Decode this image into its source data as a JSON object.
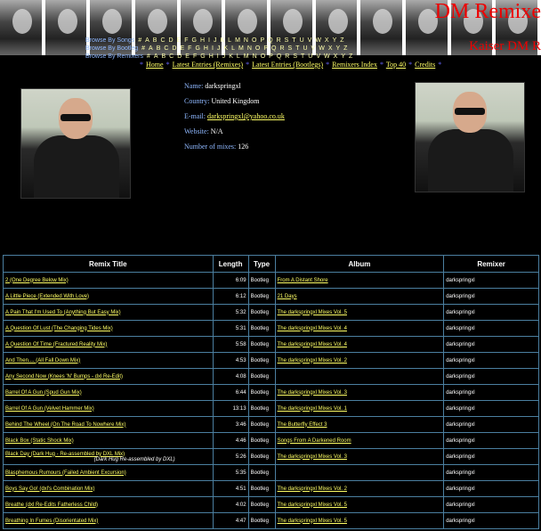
{
  "banner": {
    "title": "DM Remixe",
    "subtitle": "Kaiser DM R"
  },
  "browse_songs": {
    "label": "Browse By Songs",
    "letters": [
      "#",
      "A",
      "B",
      "C",
      "D",
      "E",
      "F",
      "G",
      "H",
      "I",
      "J",
      "K",
      "L",
      "M",
      "N",
      "O",
      "P",
      "Q",
      "R",
      "S",
      "T",
      "U",
      "V",
      "W",
      "X",
      "Y",
      "Z"
    ]
  },
  "browse_bootlegs": {
    "label": "Browse By Bootleg",
    "letters": [
      "#",
      "A",
      "B",
      "C",
      "D",
      "E",
      "F",
      "G",
      "H",
      "I",
      "J",
      "K",
      "L",
      "M",
      "N",
      "O",
      "P",
      "Q",
      "R",
      "S",
      "T",
      "U",
      "V",
      "W",
      "X",
      "Y",
      "Z"
    ]
  },
  "browse_remixers": {
    "label": "Browse By Remixers",
    "letters": [
      "#",
      "A",
      "B",
      "C",
      "D",
      "E",
      "F",
      "G",
      "H",
      "I",
      "J",
      "K",
      "L",
      "M",
      "N",
      "O",
      "P",
      "Q",
      "R",
      "S",
      "T",
      "U",
      "V",
      "W",
      "X",
      "Y",
      "Z"
    ]
  },
  "nav": {
    "home": "Home",
    "latest_remixes": "Latest Entries (Remixes)",
    "latest_bootlegs": "Latest Entries (Bootlegs)",
    "remixers_index": "Remixers Index",
    "top40": "Top 40",
    "credits": "Credits"
  },
  "profile": {
    "name_label": "Name:",
    "name": "darkspringxl",
    "country_label": "Country:",
    "country": "United Kingdom",
    "email_label": "E-mail:",
    "email": "darkspringxl@yahoo.co.uk",
    "website_label": "Website:",
    "website": "N/A",
    "mixes_label": "Number of mixes:",
    "mixes": "126"
  },
  "table": {
    "headers": [
      "Remix Title",
      "Length",
      "Type",
      "Album",
      "Remixer"
    ],
    "rows": [
      {
        "title": "2 (One Degree Below Mix)",
        "length": "6:09",
        "type": "Bootleg",
        "album": "From A Distant Shore",
        "remixer": "darkspringxl"
      },
      {
        "title": "A Little Piece (Extended With Love)",
        "length": "6:12",
        "type": "Bootleg",
        "album": "21 Days",
        "remixer": "darkspringxl"
      },
      {
        "title": "A Pain That I'm Used To (Anything But Easy Mix)",
        "length": "5:32",
        "type": "Bootleg",
        "album": "The darkspringxl Mixes Vol. 5",
        "remixer": "darkspringxl"
      },
      {
        "title": "A Question Of Lust (The Changing Tides Mix)",
        "length": "5:31",
        "type": "Bootleg",
        "album": "The darkspringxl Mixes Vol. 4",
        "remixer": "darkspringxl"
      },
      {
        "title": "A Question Of Time (Fractured Reality Mix)",
        "length": "5:58",
        "type": "Bootleg",
        "album": "The darkspringxl Mixes Vol. 4",
        "remixer": "darkspringxl"
      },
      {
        "title": "And Then.... (All Fall Down Mix)",
        "length": "4:53",
        "type": "Bootleg",
        "album": "The darkspringxl Mixes Vol. 2",
        "remixer": "darkspringxl"
      },
      {
        "title": "Any Second Now (Knees 'N' Bumps - dxl Re-Edit)",
        "length": "4:08",
        "type": "Bootleg",
        "album": "",
        "remixer": "darkspringxl"
      },
      {
        "title": "Barrel Of A Gun (Spud Gun Mix)",
        "length": "6:44",
        "type": "Bootleg",
        "album": "The darkspringxl Mixes Vol. 3",
        "remixer": "darkspringxl"
      },
      {
        "title": "Barrel Of A Gun (Velvet Hammer Mix)",
        "length": "13:13",
        "type": "Bootleg",
        "album": "The darkspringxl Mixes Vol. 1",
        "remixer": "darkspringxl"
      },
      {
        "title": "Behind The Wheel (On The Road To Nowhere Mix)",
        "length": "3:46",
        "type": "Bootleg",
        "album": "The Butterfly Effect 3",
        "remixer": "darkspringxl"
      },
      {
        "title": "Black Box (Static Shock Mix)",
        "length": "4:46",
        "type": "Bootleg",
        "album": "Songs From A Darkened Room",
        "remixer": "darkspringxl"
      },
      {
        "title": "Black Day (Dark Hug - Re-assembled by DXL Mix)",
        "note": "(Dark Hug Re-assembled by DXL)",
        "length": "5:26",
        "type": "Bootleg",
        "album": "The darkspringxl Mixes Vol. 3",
        "remixer": "darkspringxl"
      },
      {
        "title": "Blasphemous Rumours (Failed Ambient Excursion)",
        "length": "5:35",
        "type": "Bootleg",
        "album": "",
        "remixer": "darkspringxl"
      },
      {
        "title": "Boys Say Go! (dxl's Combination Mix)",
        "length": "4:51",
        "type": "Bootleg",
        "album": "The darkspringxl Mixes Vol. 2",
        "remixer": "darkspringxl"
      },
      {
        "title": "Breathe (dxl Re-Edits Fatherless Child)",
        "length": "4:02",
        "type": "Bootleg",
        "album": "The darkspringxl Mixes Vol. 5",
        "remixer": "darkspringxl"
      },
      {
        "title": "Breathing In Fumes (Disorientated Mix)",
        "length": "4:47",
        "type": "Bootleg",
        "album": "The darkspringxl Mixes Vol. 5",
        "remixer": "darkspringxl"
      }
    ]
  }
}
